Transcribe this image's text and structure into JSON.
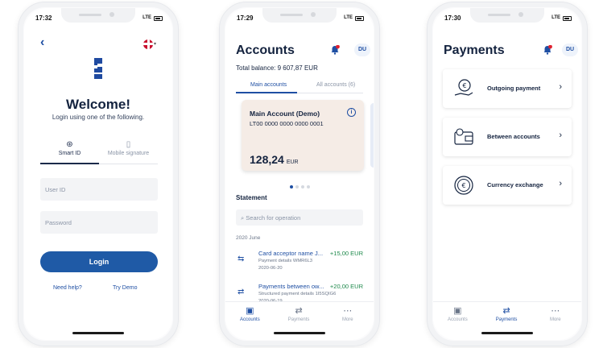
{
  "login": {
    "time": "17:32",
    "network": "LTE",
    "welcome": "Welcome!",
    "subtitle": "Login using one of the following.",
    "methods": [
      {
        "label": "Smart ID",
        "icon": "smart-id-icon"
      },
      {
        "label": "Mobile signature",
        "icon": "mobile-phone-icon"
      }
    ],
    "user_placeholder": "User ID",
    "password_placeholder": "Password",
    "login_label": "Login",
    "help_label": "Need help?",
    "demo_label": "Try Demo"
  },
  "accounts": {
    "time": "17:29",
    "network": "LTE",
    "title": "Accounts",
    "avatar": "DU",
    "balance": "Total balance: 9 607,87 EUR",
    "tabs": [
      "Main accounts",
      "All accounts (6)"
    ],
    "card": {
      "name": "Main Account (Demo)",
      "iban": "LT00 0000 0000 0000 0001",
      "amount": "128,24",
      "currency": "EUR"
    },
    "statement_label": "Statement",
    "search_placeholder": "Search for operation",
    "date_group": "2020 June",
    "transactions": [
      {
        "name": "Card acceptor name J...",
        "amount": "+15,00 EUR",
        "details": "Payment details WMR6L3",
        "date": "2020-06-20"
      },
      {
        "name": "Payments between ow...",
        "amount": "+20,00 EUR",
        "details": "Structured payment details 1I5SQIG6",
        "date": "2020-06-19"
      }
    ],
    "nav": [
      "Accounts",
      "Payments",
      "More"
    ]
  },
  "payments": {
    "time": "17:30",
    "network": "LTE",
    "title": "Payments",
    "avatar": "DU",
    "options": [
      "Outgoing payment",
      "Between accounts",
      "Currency exchange"
    ],
    "nav": [
      "Accounts",
      "Payments",
      "More"
    ]
  },
  "colors": {
    "primary": "#1f5aa6",
    "accent_link": "#1f4fa3",
    "positive": "#1f8a4c",
    "badge": "#e0212f",
    "card_bg": "#f5ece6"
  }
}
